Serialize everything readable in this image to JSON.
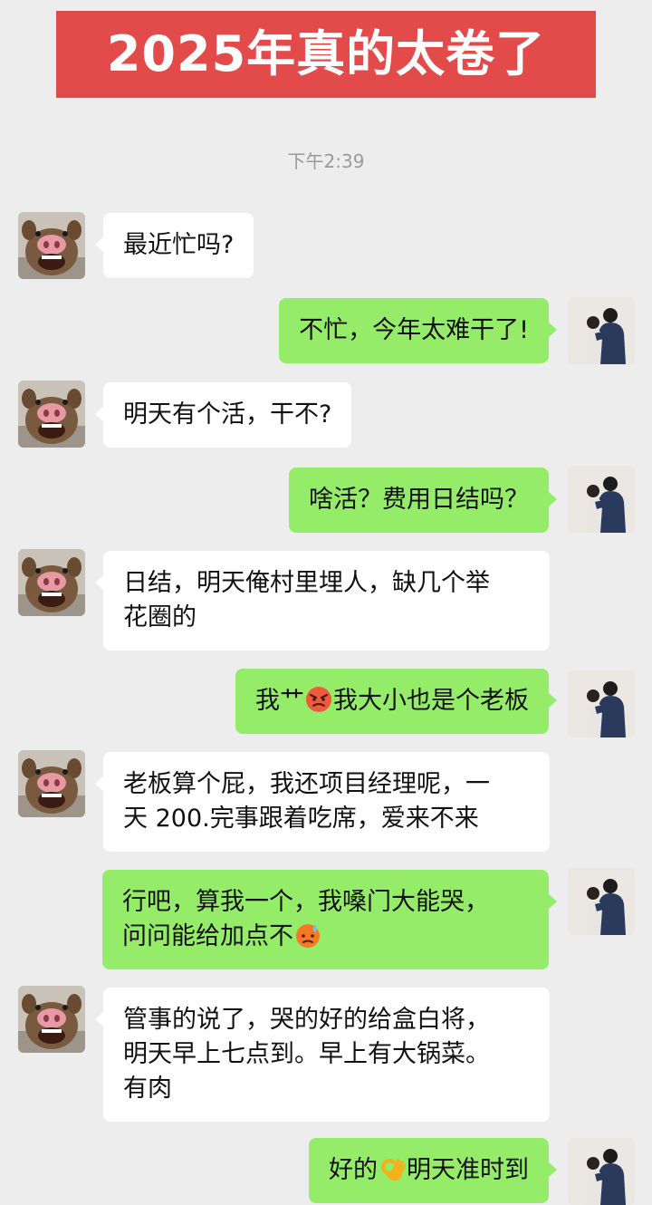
{
  "banner": {
    "title": "2025年真的太卷了"
  },
  "chat": {
    "timestamp": "下午2:39",
    "messages": [
      {
        "sender": "friend",
        "text": "最近忙吗?"
      },
      {
        "sender": "me",
        "text": "不忙，今年太难干了!"
      },
      {
        "sender": "friend",
        "text": "明天有个活，干不?"
      },
      {
        "sender": "me",
        "text": "啥活？费用日结吗？"
      },
      {
        "sender": "friend",
        "line1": "日结，明天俺村里埋人，缺几个举",
        "line2": "花圈的"
      },
      {
        "sender": "me",
        "before": "我艹",
        "emoji": "angry-face-emoji",
        "after": "我大小也是个老板"
      },
      {
        "sender": "friend",
        "line1": "老板算个屁，我还项目经理呢，一",
        "line2": "天 200.完事跟着吃席，爱来不来"
      },
      {
        "sender": "me",
        "line1": "行吧，算我一个，我嗓门大能哭，",
        "line2_before": "问问能给加点不",
        "emoji": "sweat-face-emoji"
      },
      {
        "sender": "friend",
        "line1": "管事的说了，哭的好的给盒白将，",
        "line2": "明天早上七点到。早上有大锅菜。",
        "line3": "有肉"
      },
      {
        "sender": "me",
        "before": "好的",
        "emoji": "ok-hand-emoji",
        "after": "明天准时到"
      }
    ]
  },
  "colors": {
    "banner_bg": "#e34a4a",
    "background": "#ededed",
    "bubble_left": "#ffffff",
    "bubble_right": "#95ec69",
    "timestamp": "#9a9a9a"
  },
  "icons": {
    "friend_avatar": "pig-avatar-icon",
    "my_avatar": "couple-avatar-icon"
  }
}
